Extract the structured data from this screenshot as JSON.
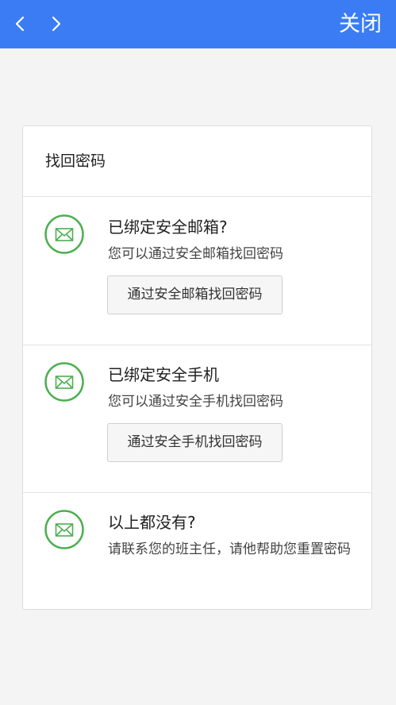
{
  "topbar": {
    "back_icon": "chevron-left-icon",
    "forward_icon": "chevron-right-icon",
    "close_label": "关闭",
    "color": "#3b7cf4"
  },
  "card": {
    "title": "找回密码",
    "options": [
      {
        "icon": "envelope-icon",
        "heading": "已绑定安全邮箱?",
        "desc": "您可以通过安全邮箱找回密码",
        "button_label": "通过安全邮箱找回密码"
      },
      {
        "icon": "envelope-icon",
        "heading": "已绑定安全手机",
        "desc": "您可以通过安全手机找回密码",
        "button_label": "通过安全手机找回密码"
      },
      {
        "icon": "envelope-icon",
        "heading": "以上都没有?",
        "desc": "请联系您的班主任，请他帮助您重置密码"
      }
    ]
  },
  "colors": {
    "accent": "#3b7cf4",
    "icon_green": "#4caf50"
  }
}
